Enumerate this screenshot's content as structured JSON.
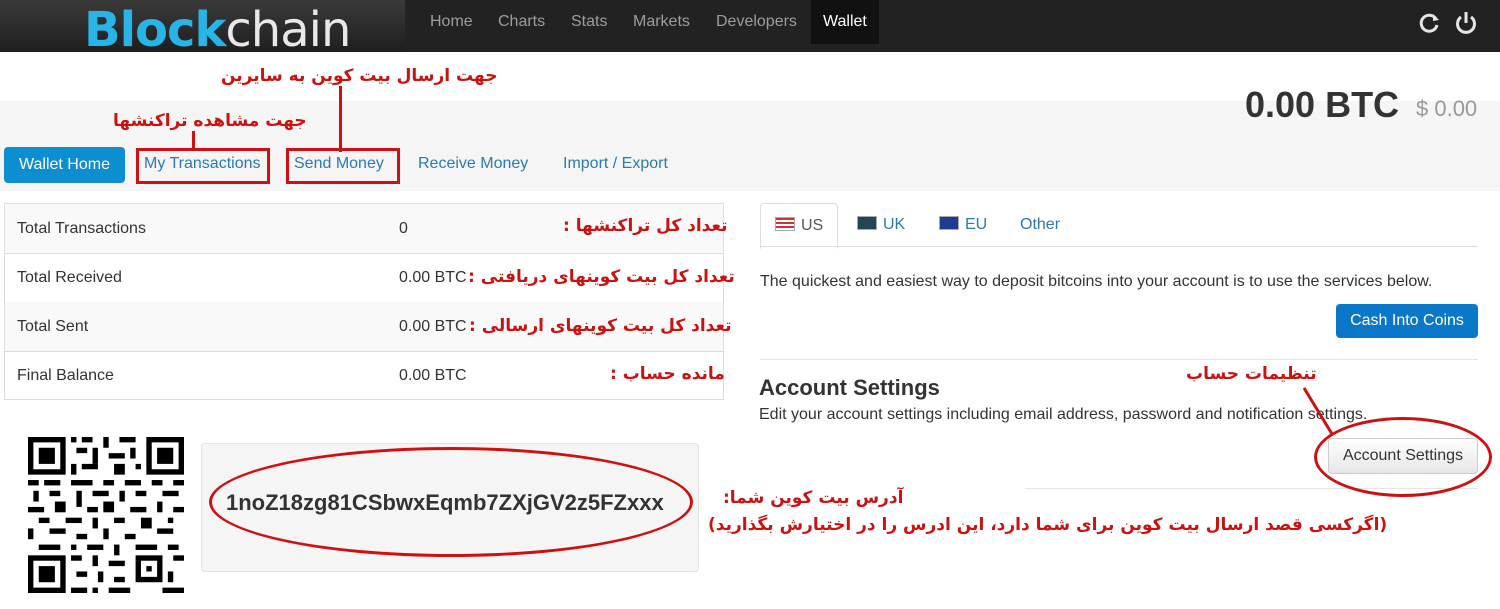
{
  "brand": {
    "logo_part1": "Bl",
    "logo_o": "o",
    "logo_part2": "ck",
    "logo_part3": "chain"
  },
  "nav": {
    "items": [
      "Home",
      "Charts",
      "Stats",
      "Markets",
      "Developers",
      "Wallet"
    ],
    "active": "Wallet",
    "icons": [
      "refresh-icon",
      "power-icon"
    ]
  },
  "balance": {
    "btc": "0.00 BTC",
    "usd": "$ 0.00"
  },
  "tabs": {
    "wallet_home": "Wallet Home",
    "my_transactions": "My Transactions",
    "send_money": "Send Money",
    "receive_money": "Receive Money",
    "import_export": "Import / Export"
  },
  "stats": [
    {
      "label": "Total Transactions",
      "value": "0"
    },
    {
      "label": "Total Received",
      "value": "0.00 BTC"
    },
    {
      "label": "Total Sent",
      "value": "0.00 BTC"
    },
    {
      "label": "Final Balance",
      "value": "0.00 BTC"
    }
  ],
  "region_tabs": [
    "US",
    "UK",
    "EU",
    "Other"
  ],
  "deposit": {
    "text": "The quickest and easiest way to deposit bitcoins into your account is to use the services below.",
    "button": "Cash Into Coins"
  },
  "account_settings": {
    "title": "Account Settings",
    "description": "Edit your account settings including email address, password and notification settings.",
    "button": "Account Settings"
  },
  "address": "1noZ18zg81CSbwxEqmb7ZXjGV2z5FZxxx",
  "annotations": {
    "send_to_others": "جهت ارسال بیت کوین به سایرین",
    "view_transactions": "جهت مشاهده تراکنشها",
    "total_transactions": "تعداد کل تراکنشها :",
    "total_received": "تعداد کل بیت کوینهای دریافتی :",
    "total_sent": "تعداد کل بیت کوینهای ارسالی :",
    "final_balance": "مانده حساب :",
    "account_settings": "تنظیمات حساب",
    "your_address": "آدرس بیت کوین شما:",
    "address_note": "(اگرکسی قصد ارسال بیت کوین برای شما دارد، این ادرس را در اختیارش بگذارید)"
  },
  "colors": {
    "primary": "#0c8ed1",
    "link": "#2a7ab0",
    "annotation": "#d01010",
    "navbar": "#222222"
  }
}
